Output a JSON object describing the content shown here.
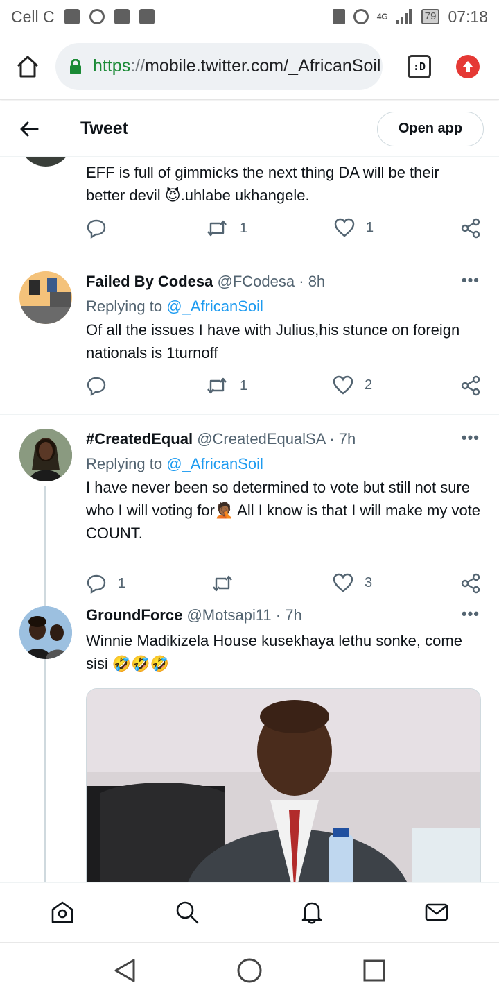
{
  "status_bar": {
    "carrier": "Cell C",
    "network": "4G",
    "battery": "79",
    "time": "07:18"
  },
  "browser": {
    "url_scheme": "https",
    "url_sep": "://",
    "url_rest": "mobile.twitter.com/_AfricanSoil",
    "tabs_label": ":D"
  },
  "header": {
    "title": "Tweet",
    "open_app": "Open app"
  },
  "tweets": [
    {
      "text": "EFF is full of gimmicks the next thing DA will be their better devil 😈.uhlabe ukhangele.",
      "reply_count": "",
      "retweet_count": "1",
      "like_count": "1"
    },
    {
      "name": "Failed By Codesa",
      "handle": "@FCodesa",
      "time": "· 8h",
      "replying_to_label": "Replying to",
      "replying_to": "@_AfricanSoil",
      "text": "Of all the issues I have with Julius,his stunce on foreign nationals is 1turnoff",
      "reply_count": "",
      "retweet_count": "1",
      "like_count": "2"
    },
    {
      "name": "#CreatedEqual",
      "handle": "@CreatedEqualSA",
      "time": "· 7h",
      "replying_to_label": "Replying to",
      "replying_to": "@_AfricanSoil",
      "text": "I have never been so determined to vote but still not sure who I will voting for🤦🏾 All I know is that I will make my vote COUNT.",
      "reply_count": "1",
      "retweet_count": "",
      "like_count": "3"
    },
    {
      "name": "GroundForce",
      "handle": "@Motsapi11",
      "time": "· 7h",
      "text": "Winnie Madikizela House kusekhaya lethu sonke, come sisi 🤣🤣🤣"
    }
  ],
  "colors": {
    "accent": "#1d9bf0",
    "secondary_text": "#536471",
    "lock_green": "#1a8a35",
    "update_red": "#e53935"
  }
}
